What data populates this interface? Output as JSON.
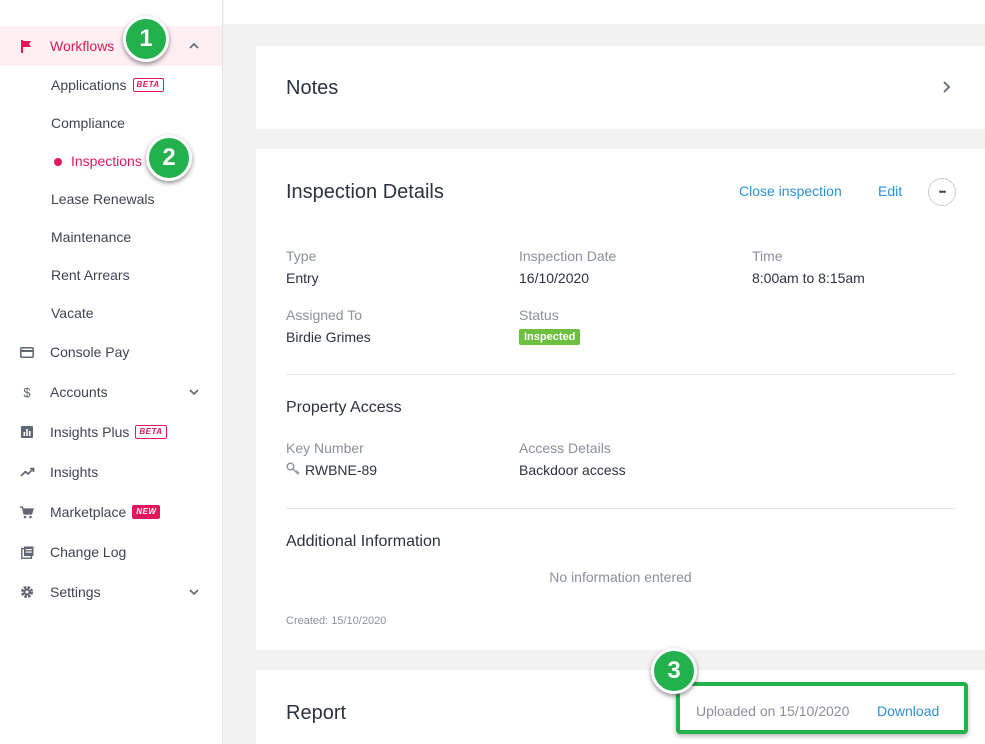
{
  "sidebar": {
    "workflows_label": "Workflows",
    "sub_items": [
      {
        "label": "Applications",
        "badge": "BETA"
      },
      {
        "label": "Compliance"
      },
      {
        "label": "Inspections"
      },
      {
        "label": "Lease Renewals"
      },
      {
        "label": "Maintenance"
      },
      {
        "label": "Rent Arrears"
      },
      {
        "label": "Vacate"
      }
    ],
    "items": [
      {
        "label": "Console Pay",
        "icon": "card-icon"
      },
      {
        "label": "Accounts",
        "icon": "dollar-icon"
      },
      {
        "label": "Insights Plus",
        "icon": "bar-chart-icon",
        "badge": "BETA"
      },
      {
        "label": "Insights",
        "icon": "trend-icon"
      },
      {
        "label": "Marketplace",
        "icon": "cart-icon",
        "badge": "NEW"
      },
      {
        "label": "Change Log",
        "icon": "log-icon"
      },
      {
        "label": "Settings",
        "icon": "gear-icon"
      }
    ]
  },
  "notes": {
    "title": "Notes"
  },
  "details": {
    "title": "Inspection Details",
    "close_label": "Close inspection",
    "edit_label": "Edit",
    "more_label": "•••",
    "fields": {
      "type_label": "Type",
      "type_value": "Entry",
      "date_label": "Inspection Date",
      "date_value": "16/10/2020",
      "time_label": "Time",
      "time_value": "8:00am to 8:15am",
      "assigned_label": "Assigned To",
      "assigned_value": "Birdie Grimes",
      "status_label": "Status",
      "status_value": "Inspected"
    },
    "property_access": {
      "title": "Property Access",
      "key_label": "Key Number",
      "key_value": "RWBNE-89",
      "access_label": "Access Details",
      "access_value": "Backdoor access"
    },
    "additional": {
      "title": "Additional Information",
      "empty": "No information entered"
    },
    "created": "Created: 15/10/2020"
  },
  "report": {
    "title": "Report",
    "uploaded": "Uploaded on 15/10/2020",
    "download_label": "Download"
  },
  "steps": [
    "1",
    "2",
    "3"
  ],
  "colors": {
    "accent": "#e0195a",
    "link": "#2b8fd8",
    "status": "#6cbf3f",
    "marker": "#23b14d"
  }
}
